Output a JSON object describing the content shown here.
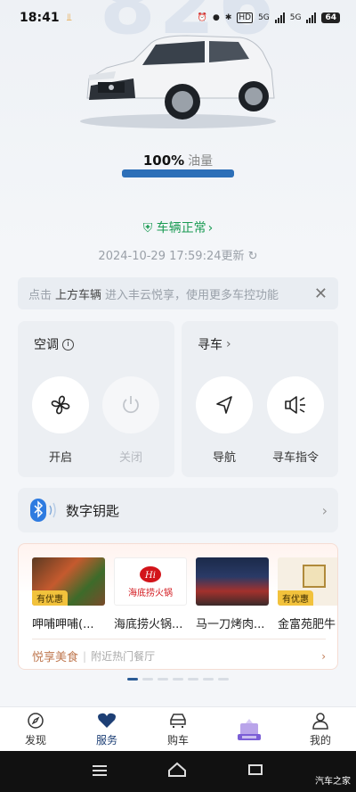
{
  "status_bar": {
    "time": "18:41",
    "hd": "HD",
    "net1": "5G",
    "net2": "5G",
    "battery": "64"
  },
  "hero": {
    "big_number": "826",
    "fuel_value": "100%",
    "fuel_label": "油量",
    "fuel_level": 1.0,
    "vehicle_status": "车辆正常",
    "update_time": "2024-10-29 17:59:24",
    "update_suffix": "更新"
  },
  "tip": {
    "prefix": "点击",
    "highlight": "上方车辆",
    "suffix": "进入丰云悦享，使用更多车控功能"
  },
  "ac_card": {
    "title": "空调",
    "on_label": "开启",
    "off_label": "关闭"
  },
  "find_car_card": {
    "title": "寻车",
    "nav_label": "导航",
    "command_label": "寻车指令"
  },
  "digital_key": {
    "label": "数字钥匙"
  },
  "food": {
    "items": [
      {
        "name": "呷哺呷哺(...",
        "badge": "有优惠"
      },
      {
        "name": "海底捞火锅...",
        "badge": "",
        "logo_text": "海底捞火锅"
      },
      {
        "name": "马一刀烤肉...",
        "badge": ""
      },
      {
        "name": "金富苑肥牛",
        "badge": "有优惠"
      }
    ],
    "footer_title": "悦享美食",
    "footer_subtitle": "附近热门餐厅"
  },
  "tabs": [
    {
      "label": "发现",
      "icon": "compass-icon"
    },
    {
      "label": "服务",
      "icon": "heart-icon"
    },
    {
      "label": "购车",
      "icon": "car-icon"
    },
    {
      "label": "",
      "icon": "gift-box-icon"
    },
    {
      "label": "我的",
      "icon": "person-icon"
    }
  ],
  "colors": {
    "accent": "#1d3f75",
    "ok_green": "#1a9b53",
    "fuel_blue": "#2d6fb8",
    "coupon_yellow": "#f2c23c"
  },
  "watermark": "汽车之家"
}
